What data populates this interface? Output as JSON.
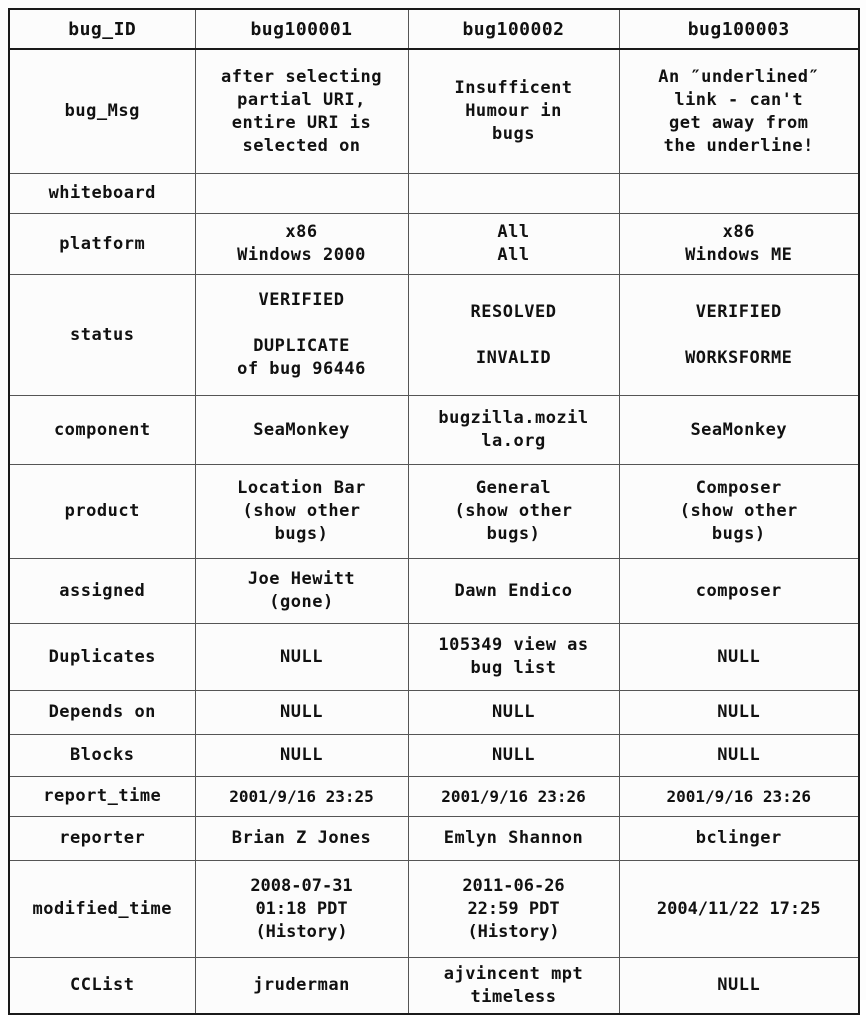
{
  "table": {
    "columns": [
      "bug_ID",
      "bug100001",
      "bug100002",
      "bug100003"
    ],
    "rows": [
      {
        "field": "bug_Msg",
        "values": [
          "after selecting\npartial URI,\nentire URI is\nselected on",
          "Insufficent\nHumour in\nbugs",
          "An ″underlined″\nlink - can't\nget away from\nthe underline!"
        ]
      },
      {
        "field": "whiteboard",
        "values": [
          "",
          "",
          ""
        ]
      },
      {
        "field": "platform",
        "values": [
          "x86\nWindows 2000",
          "All\nAll",
          "x86\nWindows ME"
        ]
      },
      {
        "field": "status",
        "values": [
          "VERIFIED\n\nDUPLICATE\nof bug 96446",
          "RESOLVED\n\nINVALID",
          "VERIFIED\n\nWORKSFORME"
        ]
      },
      {
        "field": "component",
        "values": [
          "SeaMonkey",
          "bugzilla.mozil\nla.org",
          "SeaMonkey"
        ]
      },
      {
        "field": "product",
        "values": [
          "Location Bar\n(show other\nbugs)",
          "General\n(show other\nbugs)",
          "Composer\n(show other\nbugs)"
        ]
      },
      {
        "field": "assigned",
        "values": [
          "Joe Hewitt\n(gone)",
          "Dawn Endico",
          "composer"
        ]
      },
      {
        "field": "Duplicates",
        "values": [
          "NULL",
          "105349 view as\nbug list",
          "NULL"
        ]
      },
      {
        "field": "Depends on",
        "values": [
          "NULL",
          "NULL",
          "NULL"
        ]
      },
      {
        "field": "Blocks",
        "values": [
          "NULL",
          "NULL",
          "NULL"
        ]
      },
      {
        "field": "report_time",
        "values": [
          "2001/9/16 23:25",
          "2001/9/16 23:26",
          "2001/9/16 23:26"
        ]
      },
      {
        "field": "reporter",
        "values": [
          "Brian Z Jones",
          "Emlyn Shannon",
          "bclinger"
        ]
      },
      {
        "field": "modified_time",
        "values": [
          "2008-07-31\n01:18 PDT\n(History)",
          "2011-06-26\n22:59 PDT\n(History)",
          "2004/11/22 17:25"
        ]
      },
      {
        "field": "CCList",
        "values": [
          "jruderman",
          "ajvincent mpt\ntimeless",
          "NULL"
        ]
      }
    ]
  }
}
